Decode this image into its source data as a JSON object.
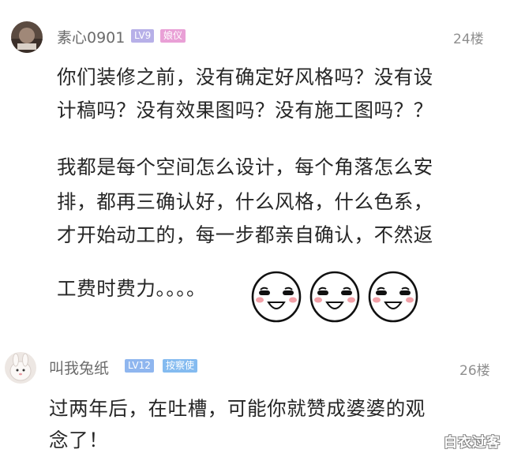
{
  "comments": [
    {
      "username": "素心0901",
      "level_badge": "LV9",
      "title_badge": "娘仪",
      "floor": "24楼",
      "paragraphs": [
        [
          "你们装修之前，没有确定好风格吗？没有设",
          "计稿吗？没有效果图吗？没有施工图吗？？"
        ],
        [
          "我都是每个空间怎么设计，每个角落怎么安",
          "排，都再三确认好，什么风格，什么色系，",
          "才开始动工的，每一步都亲自确认，不然返"
        ],
        [
          "工费时费力。。。。"
        ]
      ],
      "emoji": [
        "blushing-smile-face",
        "blushing-smile-face",
        "blushing-smile-face"
      ]
    },
    {
      "username": "叫我兔纸",
      "level_badge": "LV12",
      "title_badge": "按察使",
      "floor": "26楼",
      "paragraphs": [
        [
          "过两年后，在吐槽，可能你就赞成婆婆的观",
          "念了！"
        ]
      ]
    }
  ],
  "colors": {
    "level_badge": "#b7b0e8",
    "title_badge_1": "#e9a0d6",
    "level_badge_2": "#8fb6ef",
    "title_badge_2": "#84bbf0"
  },
  "watermark": "白衣过客"
}
